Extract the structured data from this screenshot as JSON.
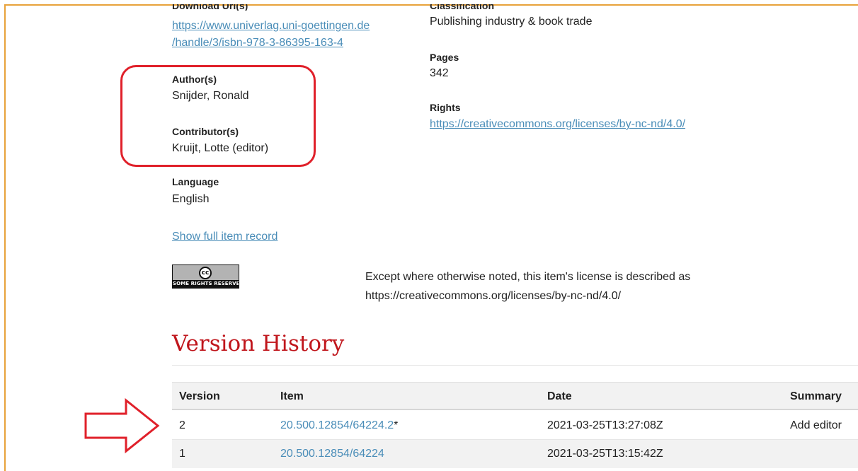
{
  "item": {
    "download_uri_label": "Download Uri(s)",
    "download_uri_line1": "https://www.univerlag.uni-goettingen.de",
    "download_uri_line2": "/handle/3/isbn-978-3-86395-163-4",
    "authors_label": "Author(s)",
    "authors_value": "Snijder, Ronald",
    "contributors_label": "Contributor(s)",
    "contributors_value": "Kruijt, Lotte (editor)",
    "language_label": "Language",
    "language_value": "English",
    "show_full_record": "Show full item record",
    "classification_label": "Classification",
    "classification_value": "Publishing industry & book trade",
    "pages_label": "Pages",
    "pages_value": "342",
    "rights_label": "Rights",
    "rights_value": "https://creativecommons.org/licenses/by-nc-nd/4.0/"
  },
  "license": {
    "badge_symbol": "cc",
    "badge_text": "SOME RIGHTS RESERVED",
    "text_line1": "Except where otherwise noted, this item's license is described as",
    "text_line2": "https://creativecommons.org/licenses/by-nc-nd/4.0/"
  },
  "version_history": {
    "title": "Version History",
    "columns": [
      "Version",
      "Item",
      "Date",
      "Summary"
    ],
    "rows": [
      {
        "version": "2",
        "item": "20.500.12854/64224.2",
        "marker": "*",
        "date": "2021-03-25T13:27:08Z",
        "summary": "Add editor"
      },
      {
        "version": "1",
        "item": "20.500.12854/64224",
        "marker": "",
        "date": "2021-03-25T13:15:42Z",
        "summary": ""
      }
    ]
  },
  "annotations": {
    "highlight_color": "#e0202a",
    "arrow_color": "#e0202a",
    "arrow_icon": "right-arrow-outline"
  },
  "colors": {
    "link": "#4a8db8",
    "heading": "#c0161c",
    "frame": "#e8a23a"
  }
}
